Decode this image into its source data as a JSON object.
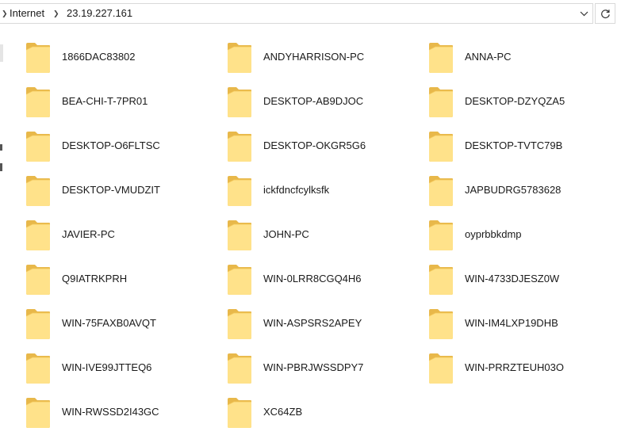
{
  "address": {
    "breadcrumbs": [
      "Internet",
      "23.19.227.161"
    ]
  },
  "icons": {
    "folder": "folder-icon",
    "dropdown": "chevron-down-icon",
    "refresh": "refresh-icon",
    "breadcrumb_separator": "chevron-right-icon"
  },
  "colors": {
    "folder_front": "#FFE28A",
    "folder_back": "#E8B84A",
    "border": "#D9D9D9"
  },
  "items": [
    {
      "name": "1866DAC83802"
    },
    {
      "name": "ANDYHARRISON-PC"
    },
    {
      "name": "ANNA-PC"
    },
    {
      "name": "BEA-CHI-T-7PR01"
    },
    {
      "name": "DESKTOP-AB9DJOC"
    },
    {
      "name": "DESKTOP-DZYQZA5"
    },
    {
      "name": "DESKTOP-O6FLTSC"
    },
    {
      "name": "DESKTOP-OKGR5G6"
    },
    {
      "name": "DESKTOP-TVTC79B"
    },
    {
      "name": "DESKTOP-VMUDZIT"
    },
    {
      "name": "ickfdncfcylksfk"
    },
    {
      "name": "JAPBUDRG5783628"
    },
    {
      "name": "JAVIER-PC"
    },
    {
      "name": "JOHN-PC"
    },
    {
      "name": "oyprbbkdmp"
    },
    {
      "name": "Q9IATRKPRH"
    },
    {
      "name": "WIN-0LRR8CGQ4H6"
    },
    {
      "name": "WIN-4733DJESZ0W"
    },
    {
      "name": "WIN-75FAXB0AVQT"
    },
    {
      "name": "WIN-ASPSRS2APEY"
    },
    {
      "name": "WIN-IM4LXP19DHB"
    },
    {
      "name": "WIN-IVE99JTTEQ6"
    },
    {
      "name": "WIN-PBRJWSSDPY7"
    },
    {
      "name": "WIN-PRRZTEUH03O"
    },
    {
      "name": "WIN-RWSSD2I43GC"
    },
    {
      "name": "XC64ZB"
    }
  ]
}
